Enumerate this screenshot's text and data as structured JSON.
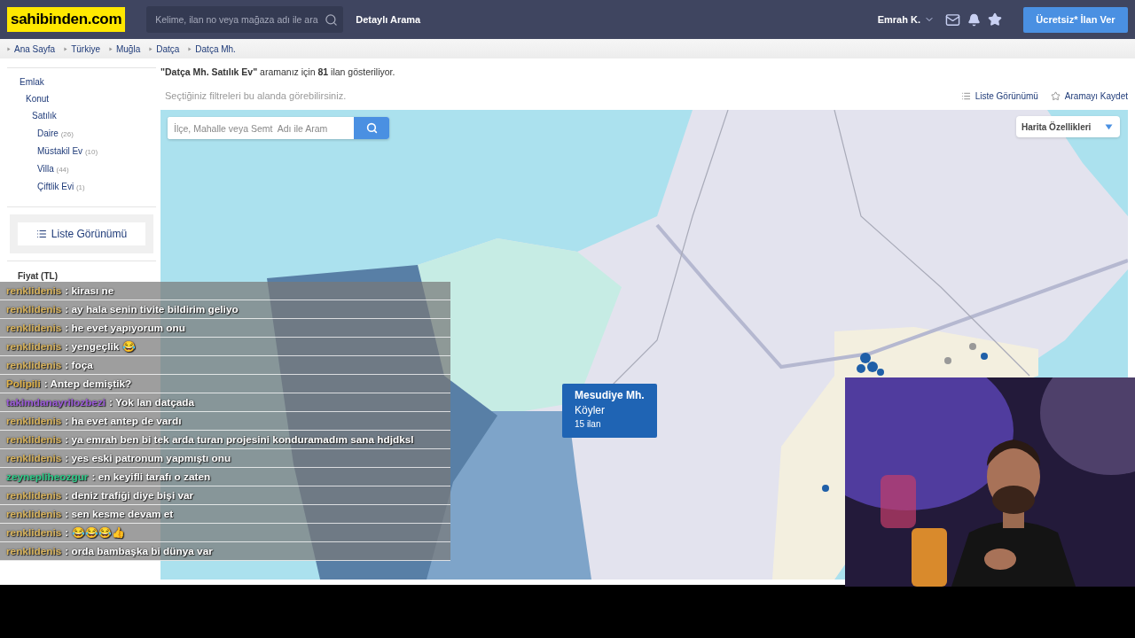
{
  "header": {
    "logo": "sahibinden.com",
    "search": {
      "placeholder": "Kelime, ilan no veya mağaza adı ile ara"
    },
    "detailed_search": "Detaylı Arama",
    "user": "Emrah K.",
    "post_button": "Ücretsiz* İlan Ver"
  },
  "breadcrumb": [
    "Ana Sayfa",
    "Türkiye",
    "Muğla",
    "Datça",
    "Datça Mh."
  ],
  "sidebar": {
    "categories": [
      {
        "label": "Emlak",
        "children": [
          {
            "label": "Konut",
            "children": [
              {
                "label": "Satılık",
                "children": [
                  {
                    "label": "Daire",
                    "count": "(26)"
                  },
                  {
                    "label": "Müstakil Ev",
                    "count": "(10)"
                  },
                  {
                    "label": "Villa",
                    "count": "(44)"
                  },
                  {
                    "label": "Çiftlik Evi",
                    "count": "(1)"
                  }
                ]
              }
            ]
          }
        ]
      }
    ],
    "list_view_button": "Liste Görünümü",
    "price_heading": "Fiyat (TL)"
  },
  "results": {
    "summary": "**\"Datça Mh. Satılık Ev\"** aramanız için **81** ilan gösteriliyor.",
    "filter_hint": "Seçtiğiniz filtreleri bu alanda görebilirsiniz.",
    "list_view_link": "Liste Görünümü",
    "save_search_link": "Aramayı Kaydet"
  },
  "map": {
    "search": {
      "placeholder": "İlçe, Mahalle veya Semt  Adı ile Aram"
    },
    "features_dropdown": "Harita Özellikleri",
    "popup": {
      "title": "Mesudiye Mh.",
      "subtitle": "Köyler",
      "count": "15 ilan"
    }
  },
  "chat": [
    {
      "user": "renklidenis",
      "color": "#d9b45e",
      "message": ": kirası ne"
    },
    {
      "user": "renklidenis",
      "color": "#d9b45e",
      "message": ": ay hala senin tivite bildirim geliyo"
    },
    {
      "user": "renklidenis",
      "color": "#d9b45e",
      "message": ": he evet yapıyorum onu"
    },
    {
      "user": "renklidenis",
      "color": "#d9b45e",
      "message": ": yengeçlik 😂"
    },
    {
      "user": "renklidenis",
      "color": "#d9b45e",
      "message": ": foça"
    },
    {
      "user": "Polipili",
      "color": "#e0b24a",
      "message": ": Antep demiştik?"
    },
    {
      "user": "takimdanayrilozbezi",
      "color": "#9b5ad8",
      "message": ": Yok lan datçada"
    },
    {
      "user": "renklidenis",
      "color": "#d9b45e",
      "message": ": ha evet antep de vardı"
    },
    {
      "user": "renklidenis",
      "color": "#d9b45e",
      "message": ": ya emrah ben bi tek arda turan projesini konduramadım sana hdjdksl"
    },
    {
      "user": "renklidenis",
      "color": "#d9b45e",
      "message": ": yes eski patronum yapmıştı onu"
    },
    {
      "user": "zeynepliheozgur",
      "color": "#2ecc8a",
      "message": ": en keyifli tarafı o zaten"
    },
    {
      "user": "renklidenis",
      "color": "#d9b45e",
      "message": ": deniz trafiği diye bişi var"
    },
    {
      "user": "renklidenis",
      "color": "#d9b45e",
      "message": ": sen kesme devam et"
    },
    {
      "user": "renklidenis",
      "color": "#d9b45e",
      "message": ": 😂😂😂👍"
    },
    {
      "user": "renklidenis",
      "color": "#d9b45e",
      "message": ": orda bambaşka bi dünya var"
    }
  ]
}
